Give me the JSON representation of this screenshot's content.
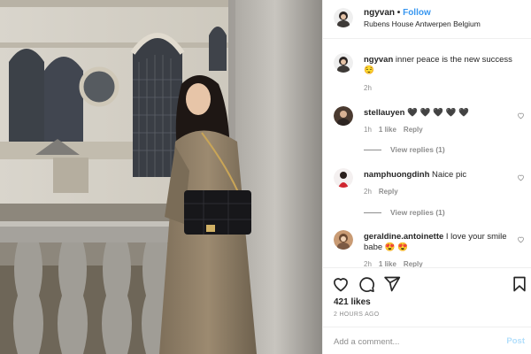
{
  "header": {
    "username": "ngyvan",
    "dot": "•",
    "follow_label": "Follow",
    "location": "Rubens House Antwerpen Belgium"
  },
  "caption": {
    "username": "ngyvan",
    "text": "inner peace is the new success 😌",
    "time": "2h"
  },
  "comments": [
    {
      "username": "stellauyen",
      "text": "🖤 🖤 🖤 🖤 🖤",
      "time": "1h",
      "likes": "1 like",
      "reply": "Reply",
      "view_replies": "View replies (1)"
    },
    {
      "username": "namphuongdinh",
      "text": "Naice pic",
      "time": "2h",
      "reply": "Reply",
      "view_replies": "View replies (1)"
    },
    {
      "username": "geraldine.antoinette",
      "text": "I love your smile babe 😍 😍",
      "time": "2h",
      "likes": "1 like",
      "reply": "Reply"
    }
  ],
  "actions": {
    "icons": [
      "heart-icon",
      "comment-icon",
      "share-icon",
      "bookmark-icon"
    ],
    "likes": "421 likes",
    "timestamp": "2 HOURS AGO"
  },
  "add_comment": {
    "placeholder": "Add a comment...",
    "post_label": "Post"
  },
  "colors": {
    "accent": "#3897f0",
    "post_disabled": "#b2dffc",
    "text": "#262626",
    "muted": "#8e8e8e"
  }
}
